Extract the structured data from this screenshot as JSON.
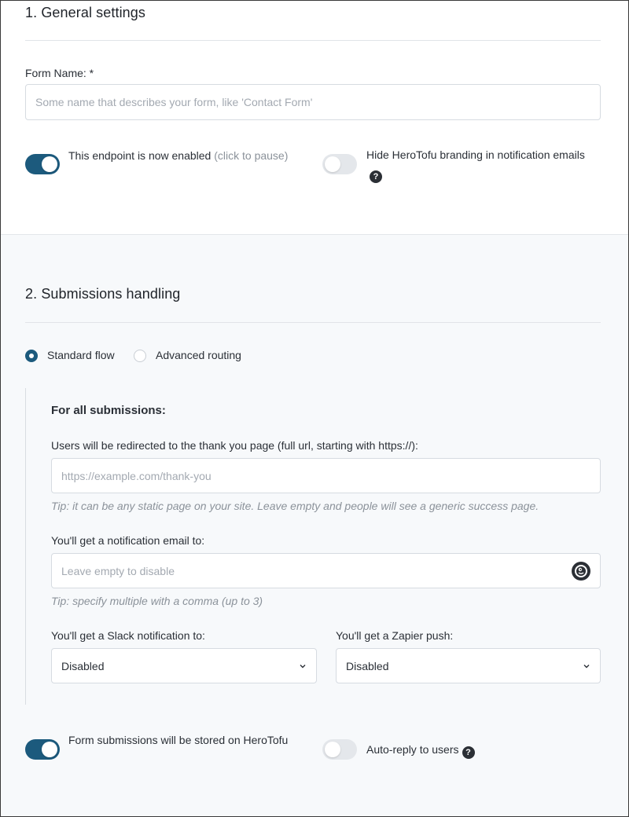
{
  "general": {
    "title": "1. General settings",
    "form_name_label": "Form Name: *",
    "form_name_placeholder": "Some name that describes your form, like 'Contact Form'",
    "endpoint_toggle": {
      "on": true,
      "text": "This endpoint is now enabled",
      "hint": "(click to pause)"
    },
    "branding_toggle": {
      "on": false,
      "text": "Hide HeroTofu branding in notification emails"
    }
  },
  "submissions": {
    "title": "2. Submissions handling",
    "flow_options": [
      {
        "label": "Standard flow",
        "selected": true
      },
      {
        "label": "Advanced routing",
        "selected": false
      }
    ],
    "for_all_title": "For all submissions:",
    "redirect_label": "Users will be redirected to the thank you page (full url, starting with https://):",
    "redirect_placeholder": "https://example.com/thank-you",
    "redirect_tip": "Tip: it can be any static page on your site. Leave empty and people will see a generic success page.",
    "email_label": "You'll get a notification email to:",
    "email_placeholder": "Leave empty to disable",
    "email_tip": "Tip: specify multiple with a comma (up to 3)",
    "slack_label": "You'll get a Slack notification to:",
    "slack_value": "Disabled",
    "zapier_label": "You'll get a Zapier push:",
    "zapier_value": "Disabled",
    "store_toggle": {
      "on": true,
      "text": "Form submissions will be stored on HeroTofu"
    },
    "autoreply_toggle": {
      "on": false,
      "text": "Auto-reply to users"
    }
  },
  "icons": {
    "help": "?",
    "help_icon": "question-circle-icon",
    "chevron": "chevron-down-icon",
    "email_extension_icon": "duckduckgo-icon"
  },
  "colors": {
    "accent": "#1c5a7d",
    "section_bg": "#f7f9fb"
  }
}
